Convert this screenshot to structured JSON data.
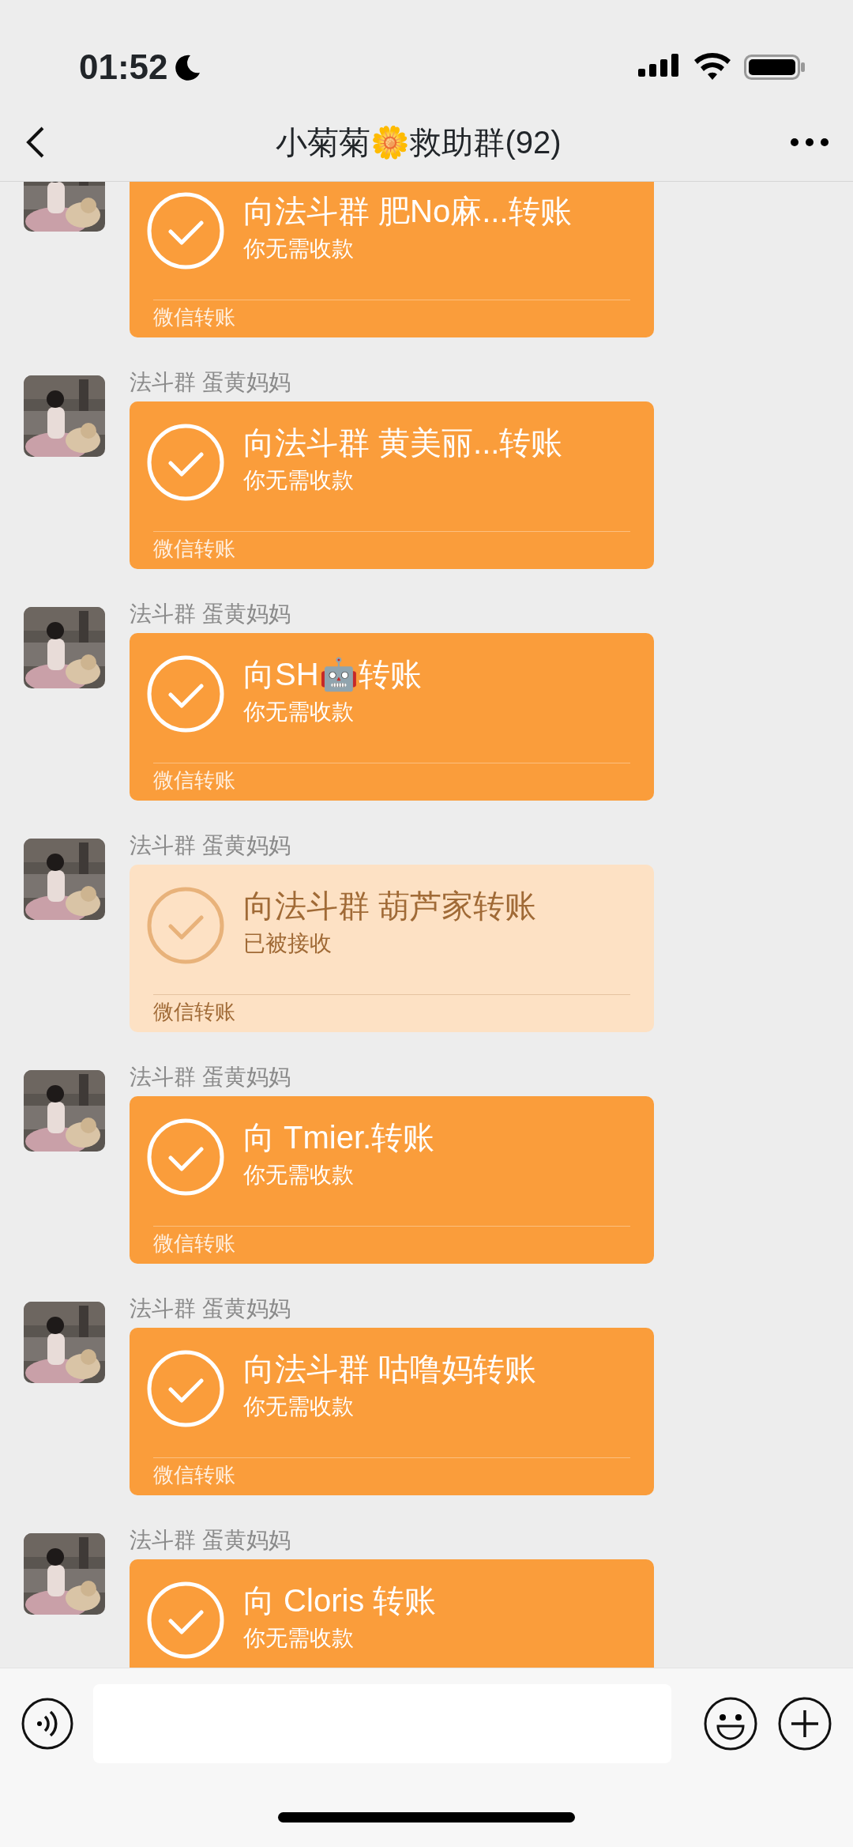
{
  "status_bar": {
    "time": "01:52"
  },
  "nav": {
    "title": "小菊菊🌼救助群(92)"
  },
  "messages": [
    {
      "title": "向法斗群 肥No麻...转账",
      "subtitle": "你无需收款",
      "footer": "微信转账",
      "received": false
    },
    {
      "sender": "法斗群 蛋黄妈妈",
      "title": "向法斗群 黄美丽...转账",
      "subtitle": "你无需收款",
      "footer": "微信转账",
      "received": false
    },
    {
      "sender": "法斗群 蛋黄妈妈",
      "title": "向SH🤖转账",
      "subtitle": "你无需收款",
      "footer": "微信转账",
      "received": false
    },
    {
      "sender": "法斗群 蛋黄妈妈",
      "title": "向法斗群 葫芦家转账",
      "subtitle": "已被接收",
      "footer": "微信转账",
      "received": true
    },
    {
      "sender": "法斗群 蛋黄妈妈",
      "title": "向 Tmier.转账",
      "subtitle": "你无需收款",
      "footer": "微信转账",
      "received": false
    },
    {
      "sender": "法斗群 蛋黄妈妈",
      "title": "向法斗群 咕噜妈转账",
      "subtitle": "你无需收款",
      "footer": "微信转账",
      "received": false
    },
    {
      "sender": "法斗群 蛋黄妈妈",
      "title": "向 Cloris 转账",
      "subtitle": "你无需收款",
      "received": false
    }
  ]
}
